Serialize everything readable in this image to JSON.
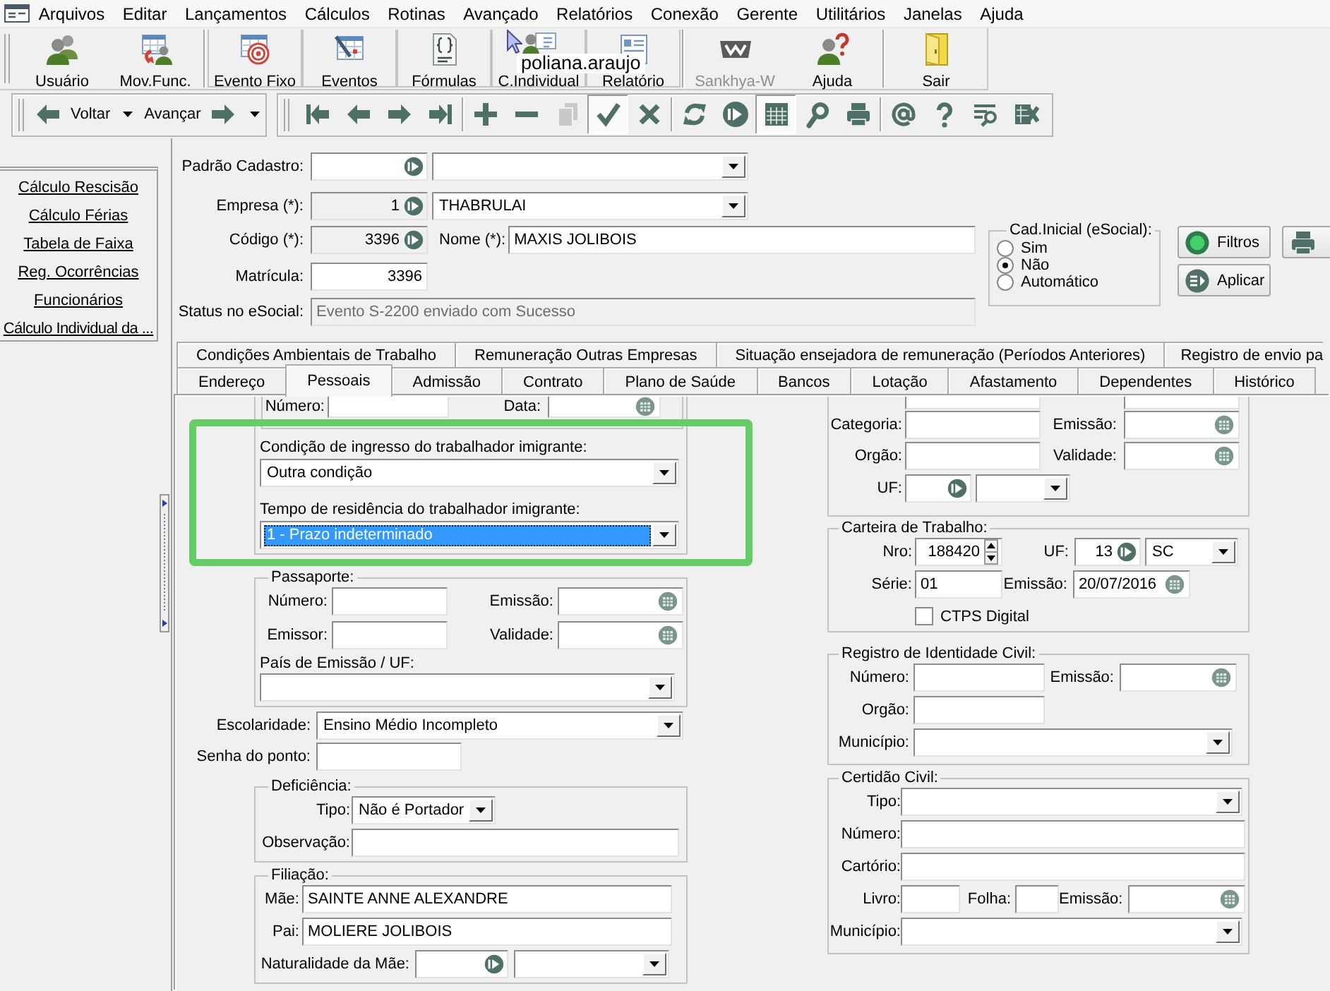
{
  "menu": {
    "items": [
      "Arquivos",
      "Editar",
      "Lançamentos",
      "Cálculos",
      "Rotinas",
      "Avançado",
      "Relatórios",
      "Conexão",
      "Gerente",
      "Utilitários",
      "Janelas",
      "Ajuda"
    ]
  },
  "toolbar": {
    "groups": [
      [
        {
          "label": "Usuário",
          "disabled": false
        },
        {
          "label": "Mov.Func.",
          "disabled": false
        }
      ],
      [
        {
          "label": "Evento Fixo",
          "disabled": false
        },
        {
          "label": "Eventos",
          "disabled": false
        },
        {
          "label": "Fórmulas",
          "disabled": false
        },
        {
          "label": "C.Individual",
          "disabled": false
        },
        {
          "label": "Relatório",
          "disabled": false
        }
      ],
      [
        {
          "label": "Sankhya-W",
          "disabled": true
        },
        {
          "label": "Ajuda",
          "disabled": false
        }
      ],
      [
        {
          "label": "Sair",
          "disabled": false
        }
      ]
    ]
  },
  "tooltip": {
    "text": "poliana.araujo"
  },
  "navigation": {
    "back": "Voltar",
    "forward": "Avançar"
  },
  "record_toolbar": {
    "groups": [
      [
        {
          "pressed": false,
          "disabled": false
        },
        {
          "pressed": false,
          "disabled": false
        },
        {
          "pressed": false,
          "disabled": false
        },
        {
          "pressed": false,
          "disabled": false
        }
      ],
      [
        {
          "pressed": false,
          "disabled": false
        },
        {
          "pressed": false,
          "disabled": false
        },
        {
          "pressed": false,
          "disabled": true
        },
        {
          "pressed": true,
          "disabled": false
        },
        {
          "pressed": false,
          "disabled": false
        }
      ],
      [
        {
          "pressed": false,
          "disabled": false
        },
        {
          "pressed": false,
          "disabled": false
        },
        {
          "pressed": true,
          "disabled": false
        },
        {
          "pressed": false,
          "disabled": false
        },
        {
          "pressed": false,
          "disabled": false
        }
      ],
      [
        {
          "pressed": false,
          "disabled": false
        },
        {
          "pressed": false,
          "disabled": false
        },
        {
          "pressed": false,
          "disabled": false
        },
        {
          "pressed": false,
          "disabled": false
        }
      ]
    ]
  },
  "side_links": [
    "Cálculo Rescisão",
    "Cálculo Férias",
    "Tabela de Faixa",
    "Reg. Ocorrências",
    "Funcionários",
    "Cálculo Individual da ..."
  ],
  "header": {
    "padrao_cadastro": {
      "label": "Padrão Cadastro:",
      "code": {
        "read_only": false
      }
    },
    "empresa": {
      "label": "Empresa (*):",
      "code": {
        "value": "1",
        "read_only": true
      },
      "value": "THABRULAI"
    },
    "codigo": {
      "label": "Código (*):",
      "value": "3396",
      "read_only": true
    },
    "nome": {
      "label": "Nome (*):",
      "value": "MAXIS JOLIBOIS"
    },
    "matricula": {
      "label": "Matrícula:",
      "value": "3396"
    },
    "status_esocial": {
      "label": "Status no eSocial:",
      "value": "Evento S-2200 enviado com Sucesso",
      "disabled": true
    },
    "cad_inicial": {
      "title": "Cad.Inicial (eSocial):",
      "options": [
        {
          "label": "Sim",
          "selected": false
        },
        {
          "label": "Não",
          "selected": true
        },
        {
          "label": "Automático",
          "selected": false
        }
      ]
    },
    "buttons": [
      {
        "label": "Filtros"
      },
      {
        "label": "Aplicar"
      }
    ]
  },
  "tabs_row_1": [
    {
      "label": "Condições Ambientais de Trabalho",
      "selected": false
    },
    {
      "label": "Remuneração Outras Empresas",
      "selected": false
    },
    {
      "label": "Situação ensejadora de remuneração (Períodos Anteriores)",
      "selected": false
    },
    {
      "label": "Registro de envio pa",
      "selected": false
    }
  ],
  "tabs_row_2": [
    {
      "label": "Endereço",
      "selected": false
    },
    {
      "label": "Pessoais",
      "selected": true
    },
    {
      "label": "Admissão",
      "selected": false
    },
    {
      "label": "Contrato",
      "selected": false
    },
    {
      "label": "Plano de Saúde",
      "selected": false
    },
    {
      "label": "Bancos",
      "selected": false
    },
    {
      "label": "Lotação",
      "selected": false
    },
    {
      "label": "Afastamento",
      "selected": false
    },
    {
      "label": "Dependentes",
      "selected": false
    },
    {
      "label": "Histórico",
      "selected": false
    }
  ],
  "pessoais": {
    "imigrante": {
      "numero": {
        "label": "Número:"
      },
      "data": {
        "label": "Data:"
      },
      "condicao_ingresso": {
        "label": "Condição de ingresso do trabalhador imigrante:",
        "value": "Outra condição",
        "focused": false
      },
      "tempo_residencia": {
        "label": "Tempo de residência do trabalhador imigrante:",
        "value": "1 - Prazo indeterminado",
        "focused": true
      }
    },
    "passaporte": {
      "title": "Passaporte:",
      "numero": {
        "label": "Número:"
      },
      "emissao": {
        "label": "Emissão:"
      },
      "emissor": {
        "label": "Emissor:"
      },
      "validade": {
        "label": "Validade:"
      },
      "pais_emissao": {
        "label": "País de Emissão / UF:"
      }
    },
    "escolaridade": {
      "label": "Escolaridade:",
      "value": "Ensino Médio Incompleto"
    },
    "senha_ponto": {
      "label": "Senha do ponto:"
    },
    "deficiencia": {
      "title": "Deficiência:",
      "tipo": {
        "label": "Tipo:",
        "value": "Não é Portador"
      },
      "observacao": {
        "label": "Observação:"
      }
    },
    "filiacao": {
      "title": "Filiação:",
      "mae": {
        "label": "Mãe:",
        "value": "SAINTE ANNE ALEXANDRE"
      },
      "pai": {
        "label": "Pai:",
        "value": "MOLIERE JOLIBOIS"
      },
      "naturalidade_mae": {
        "label": "Naturalidade da Mãe:"
      }
    },
    "group_1": {
      "categoria": {
        "label": "Categoria:"
      },
      "emissao": {
        "label": "Emissão:"
      },
      "orgao": {
        "label": "Orgão:"
      },
      "validade": {
        "label": "Validade:"
      },
      "uf": {
        "label": "UF:"
      }
    },
    "carteira_trabalho": {
      "title": "Carteira de Trabalho:",
      "nro": {
        "label": "Nro:",
        "value": "188420"
      },
      "uf": {
        "label": "UF:",
        "code": "13",
        "value": "SC"
      },
      "serie": {
        "label": "Série:",
        "value": "01"
      },
      "emissao": {
        "label": "Emissão:",
        "value": "20/07/2016"
      },
      "ctps_digital": {
        "label": "CTPS Digital",
        "checked": false
      }
    },
    "identidade_civil": {
      "title": "Registro de Identidade Civil:",
      "numero": {
        "label": "Número:"
      },
      "emissao": {
        "label": "Emissão:"
      },
      "orgao": {
        "label": "Orgão:"
      },
      "municipio": {
        "label": "Município:"
      }
    },
    "certidao_civil": {
      "title": "Certidão Civil:",
      "tipo": {
        "label": "Tipo:"
      },
      "numero": {
        "label": "Número:"
      },
      "cartorio": {
        "label": "Cartório:"
      },
      "livro": {
        "label": "Livro:"
      },
      "folha": {
        "label": "Folha:"
      },
      "emissao": {
        "label": "Emissão:"
      },
      "municipio": {
        "label": "Município:"
      }
    }
  }
}
